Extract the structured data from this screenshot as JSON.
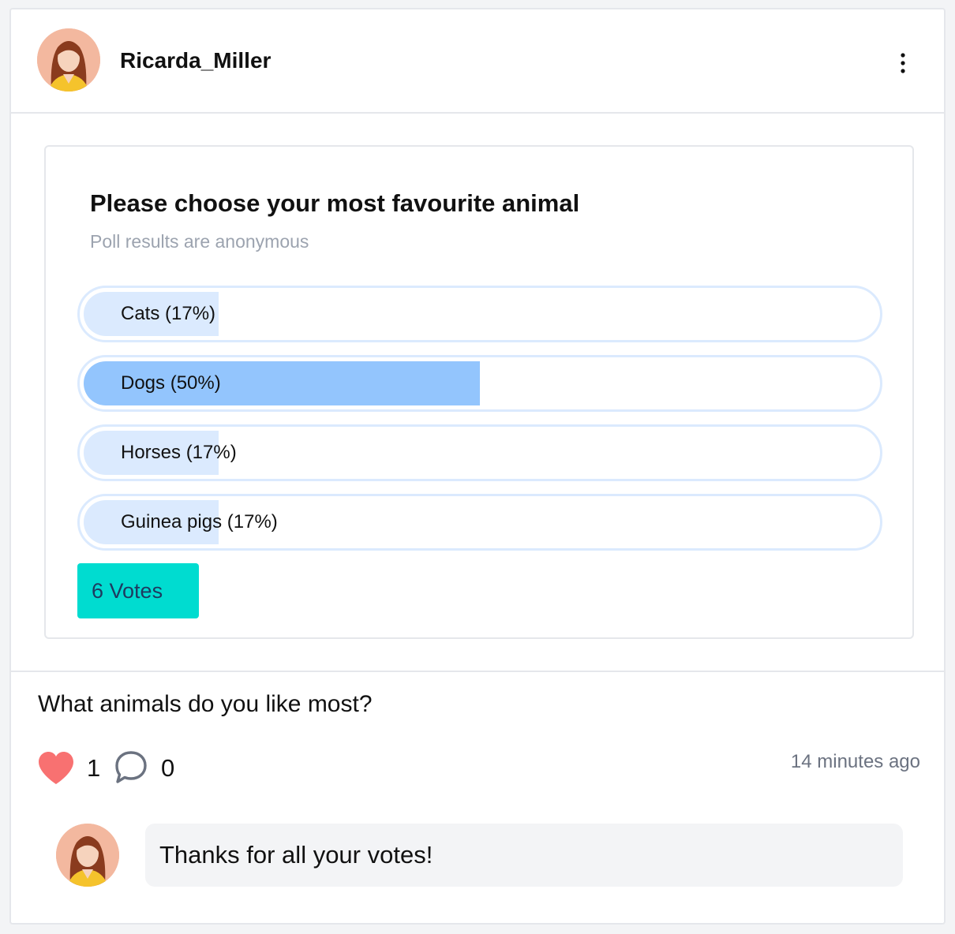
{
  "post": {
    "author": {
      "username": "Ricarda_Miller"
    },
    "menu_icon": "more-vertical-icon",
    "poll": {
      "question": "Please choose your most favourite animal",
      "subtitle": "Poll results are anonymous",
      "options": [
        {
          "label": "Cats (17%)",
          "percent": 17
        },
        {
          "label": "Dogs (50%)",
          "percent": 50,
          "leading": true
        },
        {
          "label": "Horses (17%)",
          "percent": 17
        },
        {
          "label": "Guinea pigs (17%)",
          "percent": 17
        }
      ],
      "votes_label": "6 Votes"
    },
    "text": "What animals do you like most?",
    "likes": "1",
    "comments": "0",
    "like_icon": "heart-icon",
    "comment_icon": "speech-bubble-icon",
    "timestamp": "14 minutes ago",
    "comment_entries": [
      {
        "text": "Thanks for all your votes!"
      }
    ]
  },
  "colors": {
    "like": "#f87171",
    "option_fill": "#dbeafe",
    "option_fill_leading": "#93c5fd",
    "votes_button": "#00dcd0"
  }
}
